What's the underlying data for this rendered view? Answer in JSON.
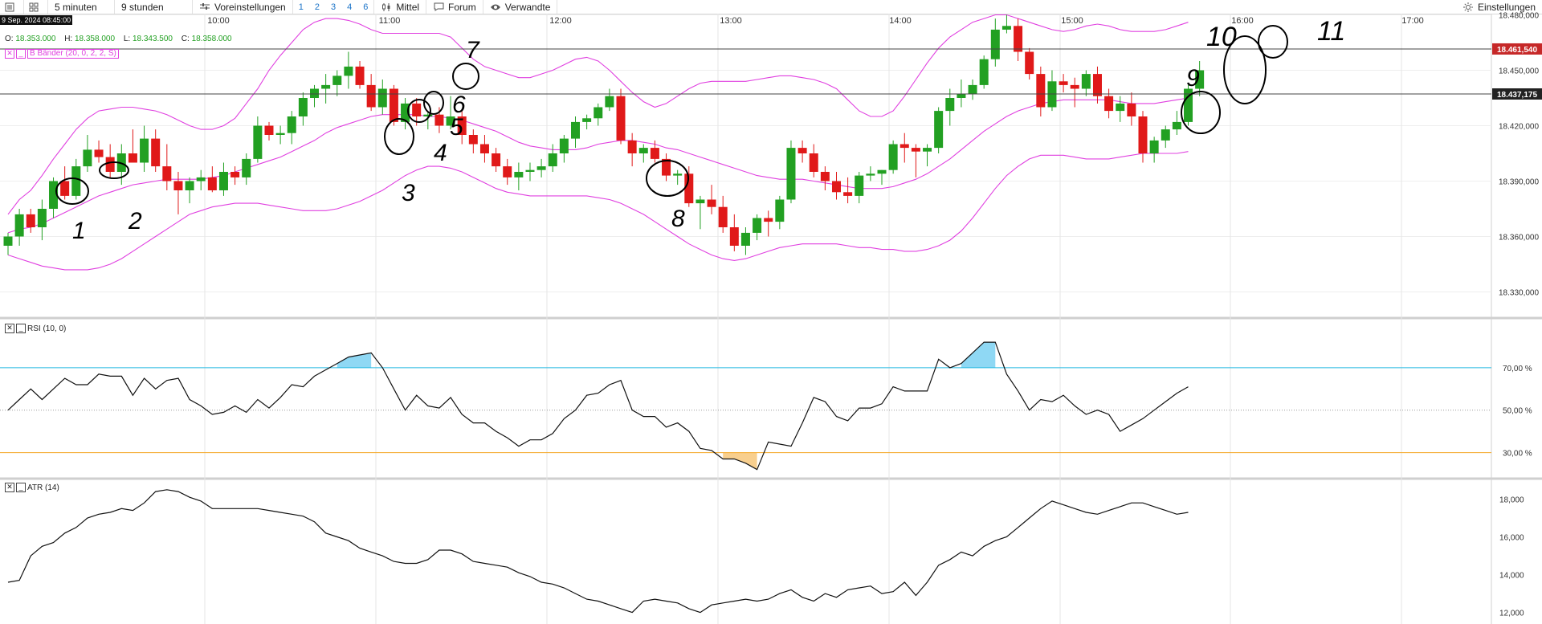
{
  "toolbar": {
    "interval": "5 minuten",
    "range": "9 stunden",
    "presets": "Voreinstellungen",
    "nums": [
      "1",
      "2",
      "3",
      "4",
      "6"
    ],
    "avg": "Mittel",
    "forum": "Forum",
    "related": "Verwandte",
    "settings": "Einstellungen",
    "icons": [
      "list-icon",
      "grid-icon",
      "sliders-icon",
      "candles-icon",
      "chat-icon",
      "eye-icon",
      "sun-icon"
    ]
  },
  "date_badge": "9 Sep. 2024 08:45:00",
  "time_labels": [
    "10:00",
    "11:00",
    "12:00",
    "13:00",
    "14:00",
    "15:00",
    "16:00",
    "17:00"
  ],
  "ohlc": {
    "o_label": "O:",
    "o": "18.353.000",
    "h_label": "H:",
    "h": "18.358.000",
    "l_label": "L:",
    "l": "18.343.500",
    "c_label": "C:",
    "c": "18.358.000"
  },
  "bollinger_legend": "B Bänder (20, 0, 2, 2, S)",
  "rsi_legend": "RSI (10, 0)",
  "atr_legend": "ATR (14)",
  "price_axis": [
    "18.480,000",
    "18.450,000",
    "18.420,000",
    "18.390,000",
    "18.360,000",
    "18.330,000"
  ],
  "price_tags": [
    {
      "label": "18.461,540",
      "value": 18461.54,
      "color": "#c62828"
    },
    {
      "label": "18.437,175",
      "value": 18437.175,
      "color": "#222222"
    }
  ],
  "rsi_axis": [
    "70,00 %",
    "50,00 %",
    "30,00 %"
  ],
  "atr_axis": [
    "18,000",
    "16,000",
    "14,000",
    "12,000"
  ],
  "annotations": [
    "1",
    "2",
    "3",
    "4",
    "5",
    "6",
    "7",
    "8",
    "9",
    "10",
    "11"
  ],
  "colors": {
    "up": "#22a022",
    "down": "#e01919",
    "band": "#e040e0",
    "rsi_over": "#20b8e0",
    "rsi_under": "#f5a623",
    "rsi_over_fill": "#8fd8f4",
    "rsi_under_fill": "#f8cf8e"
  },
  "chart_data": [
    {
      "type": "candlestick",
      "title": "",
      "x_times_first": "09:05",
      "interval_minutes": 5,
      "ylim": [
        18320,
        18490
      ],
      "candles": [
        [
          18355,
          18362,
          18350,
          18360
        ],
        [
          18360,
          18375,
          18355,
          18372
        ],
        [
          18372,
          18375,
          18362,
          18365
        ],
        [
          18365,
          18380,
          18358,
          18375
        ],
        [
          18375,
          18392,
          18370,
          18390
        ],
        [
          18390,
          18398,
          18380,
          18382
        ],
        [
          18382,
          18402,
          18380,
          18398
        ],
        [
          18398,
          18415,
          18395,
          18407
        ],
        [
          18407,
          18412,
          18400,
          18403
        ],
        [
          18403,
          18410,
          18392,
          18395
        ],
        [
          18395,
          18410,
          18388,
          18405
        ],
        [
          18405,
          18418,
          18400,
          18400
        ],
        [
          18400,
          18420,
          18395,
          18413
        ],
        [
          18413,
          18418,
          18395,
          18398
        ],
        [
          18398,
          18410,
          18385,
          18390
        ],
        [
          18390,
          18395,
          18372,
          18385
        ],
        [
          18385,
          18392,
          18378,
          18390
        ],
        [
          18390,
          18396,
          18385,
          18392
        ],
        [
          18392,
          18398,
          18384,
          18385
        ],
        [
          18385,
          18400,
          18382,
          18395
        ],
        [
          18395,
          18398,
          18388,
          18392
        ],
        [
          18392,
          18405,
          18388,
          18402
        ],
        [
          18402,
          18425,
          18400,
          18420
        ],
        [
          18420,
          18422,
          18412,
          18415
        ],
        [
          18415,
          18420,
          18410,
          18416
        ],
        [
          18416,
          18428,
          18410,
          18425
        ],
        [
          18425,
          18438,
          18420,
          18435
        ],
        [
          18435,
          18442,
          18430,
          18440
        ],
        [
          18440,
          18448,
          18432,
          18442
        ],
        [
          18442,
          18450,
          18436,
          18447
        ],
        [
          18447,
          18460,
          18440,
          18452
        ],
        [
          18452,
          18455,
          18440,
          18442
        ],
        [
          18442,
          18448,
          18428,
          18430
        ],
        [
          18430,
          18445,
          18426,
          18440
        ],
        [
          18440,
          18442,
          18420,
          18422
        ],
        [
          18422,
          18435,
          18418,
          18432
        ],
        [
          18432,
          18435,
          18420,
          18425
        ],
        [
          18425,
          18428,
          18418,
          18426
        ],
        [
          18426,
          18430,
          18416,
          18420
        ],
        [
          18420,
          18436,
          18418,
          18425
        ],
        [
          18425,
          18428,
          18410,
          18415
        ],
        [
          18415,
          18418,
          18405,
          18410
        ],
        [
          18410,
          18415,
          18400,
          18405
        ],
        [
          18405,
          18408,
          18395,
          18398
        ],
        [
          18398,
          18402,
          18388,
          18392
        ],
        [
          18392,
          18400,
          18385,
          18395
        ],
        [
          18395,
          18400,
          18390,
          18396
        ],
        [
          18396,
          18402,
          18392,
          18398
        ],
        [
          18398,
          18410,
          18395,
          18405
        ],
        [
          18405,
          18415,
          18400,
          18413
        ],
        [
          18413,
          18425,
          18408,
          18422
        ],
        [
          18422,
          18426,
          18418,
          18424
        ],
        [
          18424,
          18432,
          18420,
          18430
        ],
        [
          18430,
          18440,
          18428,
          18436
        ],
        [
          18436,
          18440,
          18410,
          18412
        ],
        [
          18412,
          18416,
          18398,
          18405
        ],
        [
          18405,
          18410,
          18400,
          18408
        ],
        [
          18408,
          18412,
          18400,
          18402
        ],
        [
          18402,
          18405,
          18390,
          18393
        ],
        [
          18393,
          18396,
          18388,
          18394
        ],
        [
          18394,
          18398,
          18376,
          18378
        ],
        [
          18378,
          18382,
          18364,
          18380
        ],
        [
          18380,
          18388,
          18372,
          18376
        ],
        [
          18376,
          18382,
          18362,
          18365
        ],
        [
          18365,
          18372,
          18352,
          18355
        ],
        [
          18355,
          18365,
          18350,
          18362
        ],
        [
          18362,
          18372,
          18358,
          18370
        ],
        [
          18370,
          18374,
          18360,
          18368
        ],
        [
          18368,
          18382,
          18364,
          18380
        ],
        [
          18380,
          18412,
          18378,
          18408
        ],
        [
          18408,
          18412,
          18400,
          18405
        ],
        [
          18405,
          18410,
          18392,
          18395
        ],
        [
          18395,
          18398,
          18385,
          18390
        ],
        [
          18390,
          18395,
          18380,
          18384
        ],
        [
          18384,
          18392,
          18378,
          18382
        ],
        [
          18382,
          18395,
          18378,
          18393
        ],
        [
          18393,
          18398,
          18390,
          18394
        ],
        [
          18394,
          18396,
          18388,
          18396
        ],
        [
          18396,
          18412,
          18394,
          18410
        ],
        [
          18410,
          18416,
          18400,
          18408
        ],
        [
          18408,
          18410,
          18392,
          18406
        ],
        [
          18406,
          18410,
          18398,
          18408
        ],
        [
          18408,
          18430,
          18405,
          18428
        ],
        [
          18428,
          18440,
          18420,
          18435
        ],
        [
          18435,
          18445,
          18430,
          18437
        ],
        [
          18437,
          18445,
          18434,
          18442
        ],
        [
          18442,
          18458,
          18440,
          18456
        ],
        [
          18456,
          18478,
          18452,
          18472
        ],
        [
          18472,
          18480,
          18470,
          18474
        ],
        [
          18474,
          18478,
          18455,
          18460
        ],
        [
          18460,
          18462,
          18445,
          18448
        ],
        [
          18448,
          18452,
          18425,
          18430
        ],
        [
          18430,
          18450,
          18428,
          18444
        ],
        [
          18444,
          18448,
          18438,
          18442
        ],
        [
          18442,
          18446,
          18430,
          18440
        ],
        [
          18440,
          18450,
          18436,
          18448
        ],
        [
          18448,
          18452,
          18432,
          18436
        ],
        [
          18436,
          18440,
          18424,
          18428
        ],
        [
          18428,
          18436,
          18422,
          18432
        ],
        [
          18432,
          18438,
          18420,
          18425
        ],
        [
          18425,
          18428,
          18400,
          18405
        ],
        [
          18405,
          18414,
          18400,
          18412
        ],
        [
          18412,
          18420,
          18408,
          18418
        ],
        [
          18418,
          18428,
          18415,
          18422
        ],
        [
          18422,
          18442,
          18420,
          18440
        ],
        [
          18440,
          18455,
          18436,
          18450
        ]
      ],
      "bb_upper": [
        18372,
        18380,
        18385,
        18393,
        18402,
        18410,
        18418,
        18424,
        18428,
        18429,
        18430,
        18430,
        18429,
        18428,
        18426,
        18423,
        18420,
        18418,
        18418,
        18420,
        18424,
        18432,
        18440,
        18450,
        18458,
        18465,
        18472,
        18476,
        18478,
        18478,
        18477,
        18475,
        18472,
        18470,
        18470,
        18470,
        18470,
        18470,
        18470,
        18468,
        18462,
        18456,
        18452,
        18450,
        18448,
        18446,
        18446,
        18448,
        18450,
        18453,
        18456,
        18457,
        18455,
        18450,
        18444,
        18438,
        18433,
        18430,
        18432,
        18436,
        18440,
        18443,
        18444,
        18444,
        18444,
        18444,
        18445,
        18446,
        18447,
        18447,
        18446,
        18445,
        18443,
        18440,
        18434,
        18428,
        18425,
        18425,
        18428,
        18436,
        18445,
        18454,
        18462,
        18468,
        18472,
        18476,
        18478,
        18480,
        18480,
        18478,
        18476,
        18474,
        18472,
        18471,
        18472,
        18474,
        18475,
        18474,
        18472,
        18471,
        18471,
        18471,
        18472,
        18474,
        18476
      ],
      "bb_mid": [
        18362,
        18364,
        18365,
        18367,
        18370,
        18373,
        18376,
        18379,
        18382,
        18384,
        18386,
        18388,
        18389,
        18390,
        18391,
        18391,
        18391,
        18391,
        18392,
        18393,
        18395,
        18397,
        18399,
        18401,
        18403,
        18406,
        18409,
        18412,
        18416,
        18419,
        18421,
        18423,
        18425,
        18426,
        18426,
        18426,
        18426,
        18425,
        18425,
        18424,
        18423,
        18421,
        18419,
        18417,
        18414,
        18411,
        18409,
        18408,
        18407,
        18407,
        18407,
        18408,
        18410,
        18411,
        18412,
        18412,
        18411,
        18410,
        18408,
        18407,
        18405,
        18403,
        18401,
        18399,
        18397,
        18395,
        18393,
        18392,
        18391,
        18391,
        18391,
        18390,
        18389,
        18388,
        18387,
        18386,
        18386,
        18386,
        18387,
        18389,
        18391,
        18394,
        18398,
        18402,
        18407,
        18412,
        18417,
        18421,
        18425,
        18428,
        18430,
        18432,
        18433,
        18434,
        18434,
        18434,
        18434,
        18434,
        18433,
        18432,
        18432,
        18432,
        18433,
        18434,
        18435
      ],
      "bb_lower": [
        18350,
        18348,
        18346,
        18344,
        18343,
        18342,
        18342,
        18342,
        18343,
        18345,
        18348,
        18352,
        18356,
        18360,
        18364,
        18368,
        18372,
        18374,
        18376,
        18377,
        18378,
        18378,
        18378,
        18377,
        18376,
        18375,
        18374,
        18374,
        18374,
        18375,
        18377,
        18379,
        18382,
        18385,
        18389,
        18393,
        18396,
        18398,
        18398,
        18397,
        18395,
        18392,
        18389,
        18386,
        18384,
        18383,
        18382,
        18382,
        18382,
        18382,
        18382,
        18382,
        18381,
        18380,
        18378,
        18375,
        18372,
        18368,
        18364,
        18360,
        18356,
        18353,
        18350,
        18348,
        18347,
        18348,
        18350,
        18352,
        18354,
        18355,
        18356,
        18356,
        18356,
        18356,
        18355,
        18354,
        18354,
        18353,
        18353,
        18352,
        18352,
        18353,
        18355,
        18358,
        18363,
        18370,
        18378,
        18386,
        18393,
        18398,
        18402,
        18404,
        18404,
        18404,
        18403,
        18402,
        18402,
        18402,
        18403,
        18404,
        18405,
        18405,
        18405,
        18405,
        18406
      ]
    },
    {
      "type": "line",
      "title": "",
      "ylim": [
        20,
        90
      ],
      "levels": [
        70,
        50,
        30
      ],
      "values": [
        50,
        55,
        60,
        55,
        60,
        65,
        62,
        62,
        67,
        66,
        66,
        57,
        65,
        60,
        64,
        65,
        55,
        52,
        48,
        49,
        52,
        49,
        55,
        51,
        56,
        62,
        61,
        66,
        69,
        72,
        75,
        76,
        77,
        70,
        60,
        50,
        57,
        52,
        51,
        56,
        48,
        44,
        44,
        40,
        37,
        33,
        36,
        36,
        39,
        46,
        50,
        57,
        58,
        62,
        64,
        50,
        47,
        47,
        42,
        44,
        40,
        32,
        31,
        27,
        27,
        25,
        22,
        35,
        34,
        33,
        44,
        56,
        54,
        47,
        45,
        51,
        51,
        53,
        61,
        59,
        59,
        59,
        74,
        70,
        72,
        77,
        82,
        82,
        67,
        59,
        50,
        55,
        54,
        57,
        52,
        48,
        50,
        48,
        40,
        43,
        46,
        50,
        54,
        58,
        61
      ]
    },
    {
      "type": "line",
      "title": "",
      "ylim": [
        11.6,
        19.0
      ],
      "values": [
        13.6,
        13.7,
        15.0,
        15.5,
        15.7,
        16.2,
        16.5,
        17.0,
        17.2,
        17.3,
        17.5,
        17.4,
        17.8,
        18.4,
        18.5,
        18.4,
        18.1,
        17.9,
        17.5,
        17.5,
        17.5,
        17.5,
        17.5,
        17.4,
        17.3,
        17.2,
        17.1,
        16.8,
        16.2,
        16.0,
        15.8,
        15.4,
        15.2,
        15.0,
        14.7,
        14.6,
        14.6,
        14.8,
        15.3,
        15.3,
        15.1,
        14.7,
        14.6,
        14.5,
        14.4,
        14.1,
        13.9,
        13.6,
        13.5,
        13.3,
        13.0,
        12.7,
        12.6,
        12.4,
        12.2,
        12.0,
        12.6,
        12.7,
        12.6,
        12.5,
        12.2,
        12.0,
        12.4,
        12.5,
        12.6,
        12.7,
        12.6,
        12.7,
        13.0,
        13.2,
        12.8,
        12.6,
        13.0,
        12.8,
        13.2,
        13.3,
        13.4,
        13.0,
        13.1,
        13.6,
        12.9,
        13.6,
        14.5,
        14.8,
        15.2,
        15.0,
        15.5,
        15.8,
        16.0,
        16.5,
        17.0,
        17.5,
        17.9,
        17.7,
        17.5,
        17.3,
        17.2,
        17.4,
        17.6,
        17.8,
        17.8,
        17.6,
        17.4,
        17.2,
        17.3
      ]
    }
  ]
}
